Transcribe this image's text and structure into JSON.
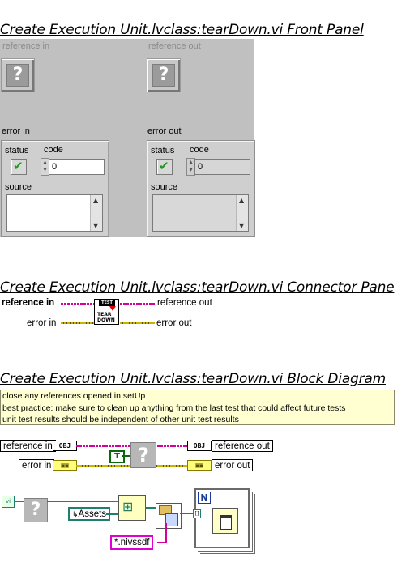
{
  "front_panel": {
    "title": "Create Execution Unit.lvclass:tearDown.vi Front Panel",
    "reference_in": {
      "label": "reference in",
      "icon": "unknown-class-icon",
      "glyph": "?"
    },
    "reference_out": {
      "label": "reference out",
      "icon": "unknown-class-icon",
      "glyph": "?"
    },
    "error_in": {
      "label": "error in",
      "status_label": "status",
      "code_label": "code",
      "code_value": "0",
      "source_label": "source",
      "source_value": "",
      "status_icon": "checkmark-icon"
    },
    "error_out": {
      "label": "error out",
      "status_label": "status",
      "code_label": "code",
      "code_value": "0",
      "source_label": "source",
      "source_value": "",
      "status_icon": "checkmark-icon"
    }
  },
  "connector_pane": {
    "title": "Create Execution Unit.lvclass:tearDown.vi Connector Pane",
    "left_top": "reference in",
    "left_bottom": "error in",
    "right_top": "reference out",
    "right_bottom": "error out",
    "vi_icon_top": "TEST",
    "vi_icon_line1": "TEAR",
    "vi_icon_line2": "DOWN"
  },
  "block_diagram": {
    "title": "Create Execution Unit.lvclass:tearDown.vi Block Diagram",
    "comment_lines": [
      "close any references opened in setUp",
      "best practice: make sure to clean up anything from the last test that could affect future tests",
      "unit test results should be independent of other unit test results"
    ],
    "terminals": {
      "reference_in": "reference in",
      "error_in": "error in",
      "reference_out": "reference out",
      "error_out": "error out"
    },
    "obj_glyph": "OBJ",
    "bool_const": "T",
    "unknown_glyph": "?",
    "assets_const": "Assets",
    "pattern_const": "*.nivssdf",
    "for_loop_count": "N",
    "vi_ref_glyph": "vi"
  },
  "colors": {
    "front_panel_bg": "#c0c0c0",
    "class_wire": "#d4009a",
    "error_wire": "#c9b400",
    "string_wire": "#d4009a",
    "ref_wire": "#1f7f6f",
    "comment_bg": "#ffffd2"
  }
}
